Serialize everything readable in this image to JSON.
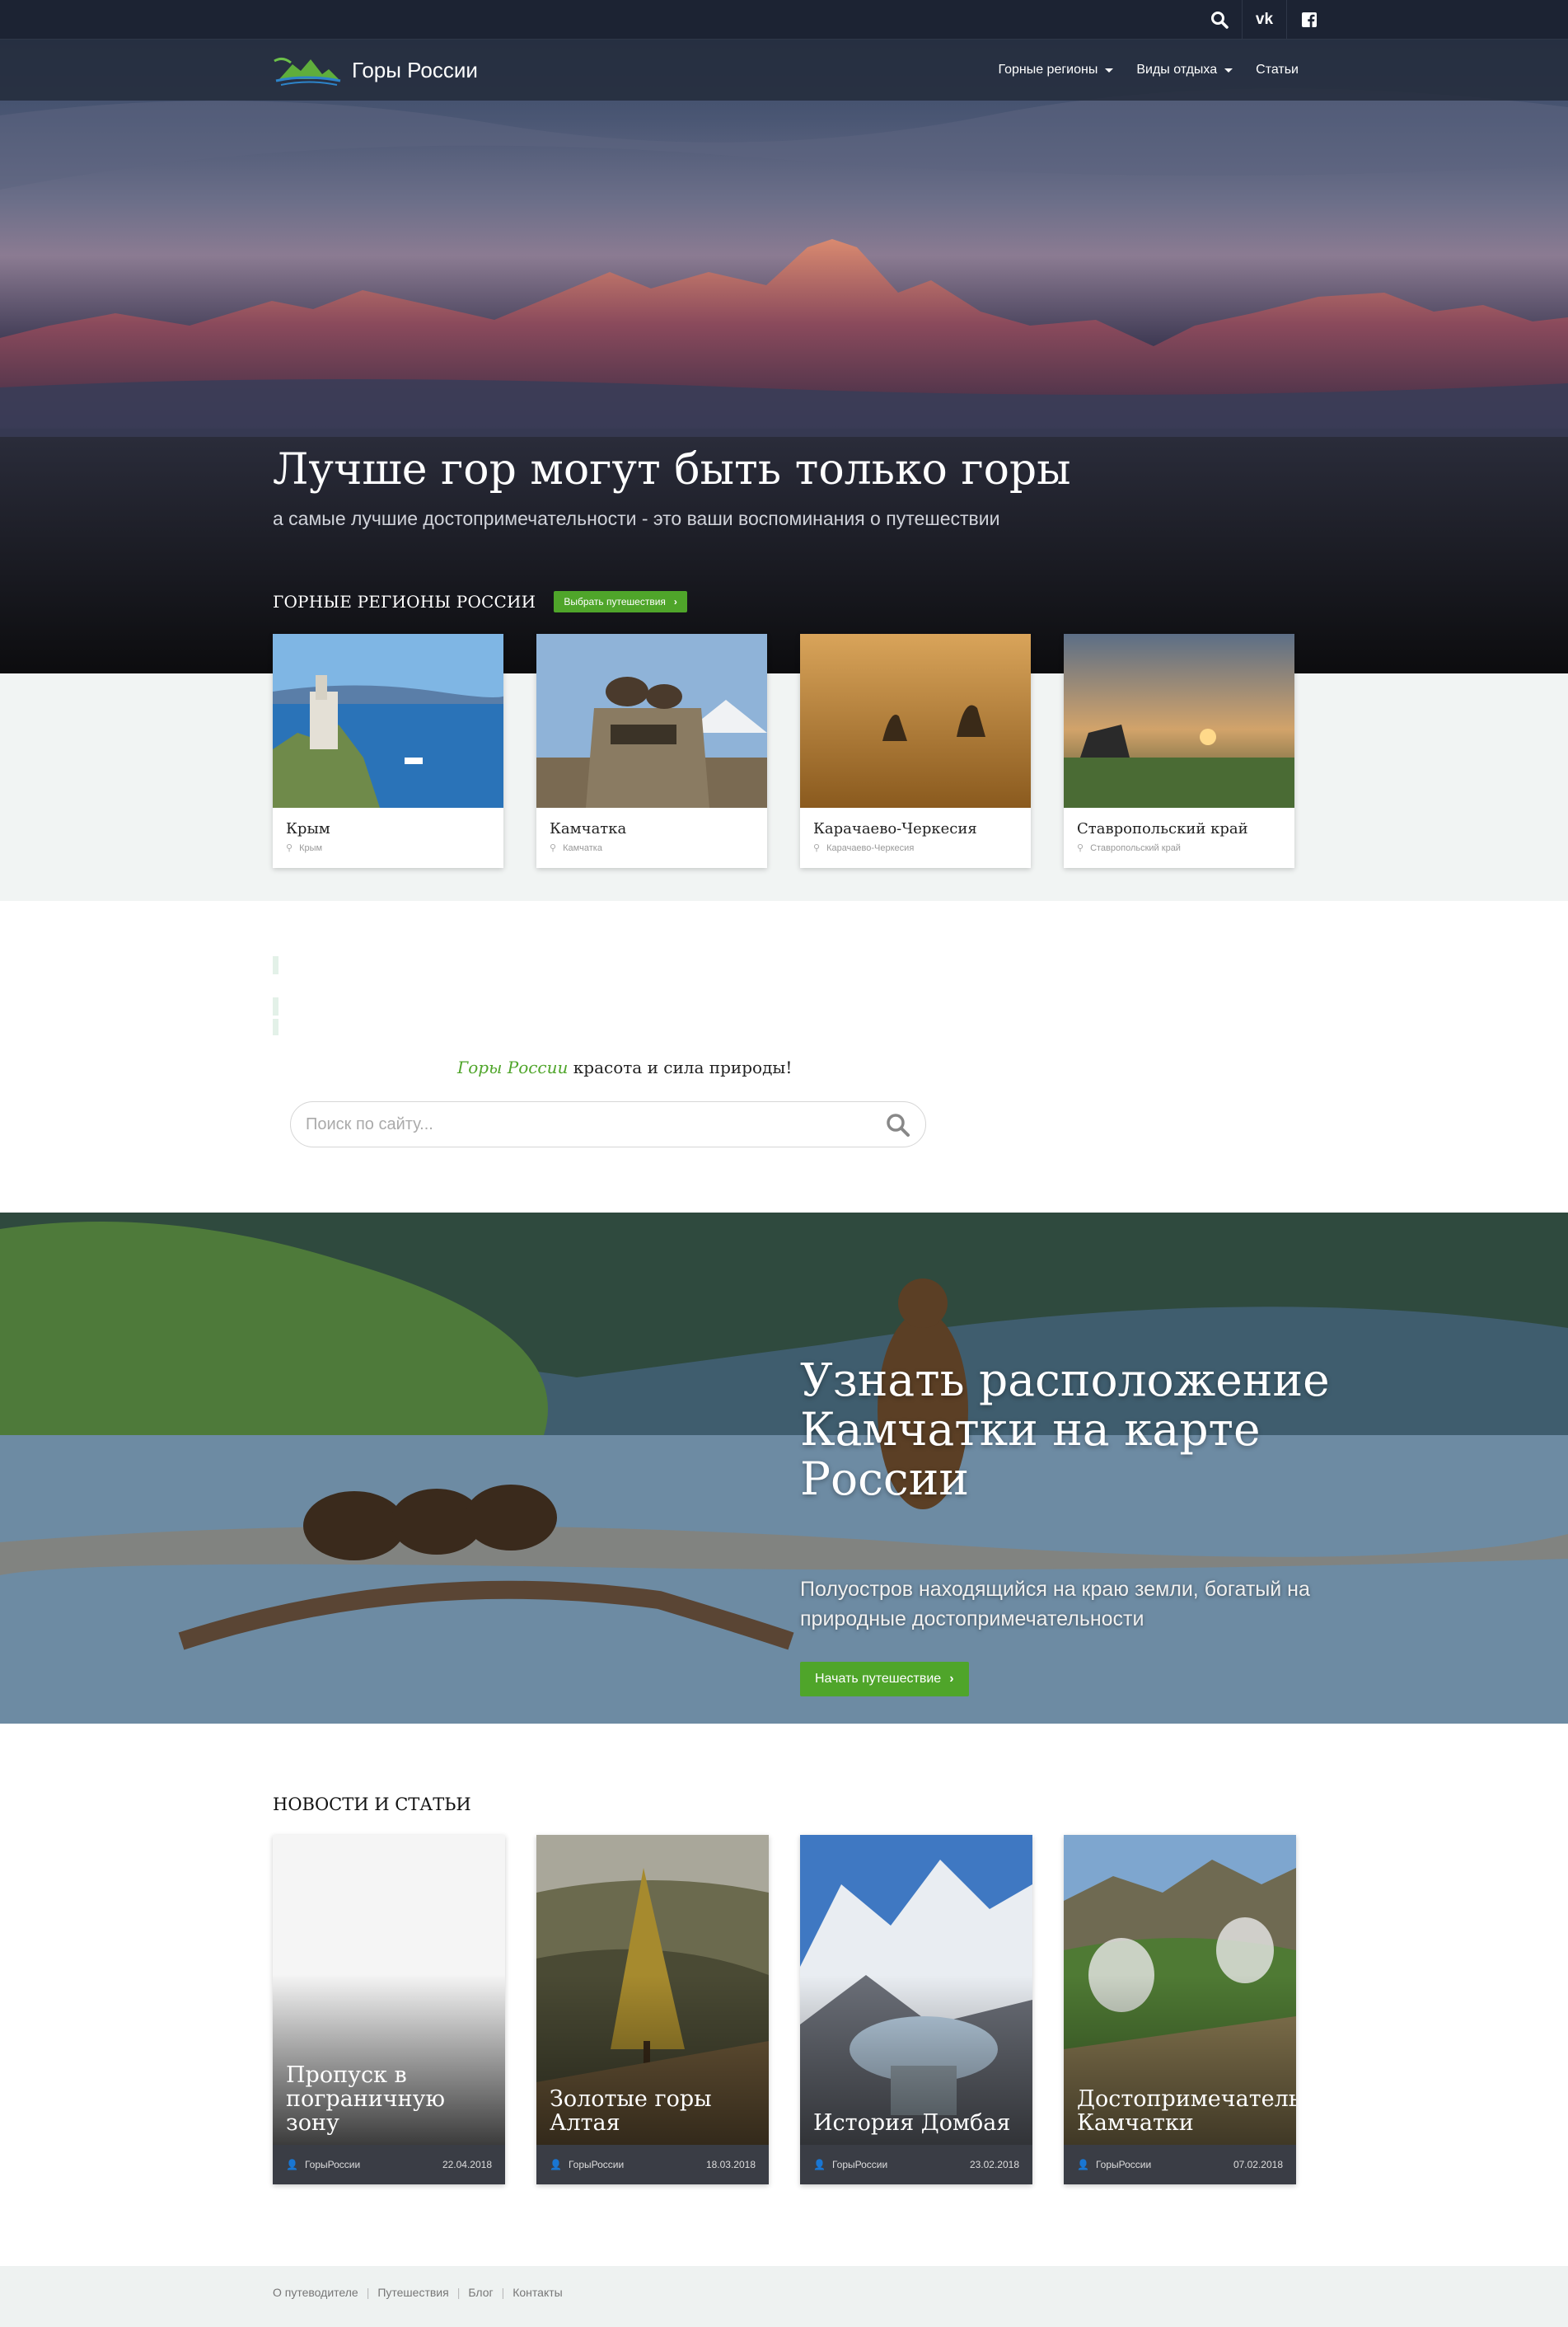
{
  "header": {
    "brand": "Горы России",
    "top_icons": [
      "search-icon",
      "vk-icon",
      "facebook-icon"
    ],
    "menu": [
      {
        "label": "Горные регионы",
        "dropdown": true
      },
      {
        "label": "Виды отдыха",
        "dropdown": true
      },
      {
        "label": "Статьи",
        "dropdown": false
      }
    ]
  },
  "hero": {
    "title": "Лучше гор могут быть только горы",
    "subtitle": "а самые лучшие достопримечательности - это ваши воспоминания о путешествии"
  },
  "regions": {
    "title": "ГОРНЫЕ РЕГИОНЫ РОССИИ",
    "button": "Выбрать путешествия",
    "cards": [
      {
        "name": "Крым",
        "location": "Крым"
      },
      {
        "name": "Камчатка",
        "location": "Камчатка"
      },
      {
        "name": "Карачаево-Черкесия",
        "location": "Карачаево-Черкесия"
      },
      {
        "name": "Ставропольский край",
        "location": "Ставропольский край"
      }
    ]
  },
  "tagline": {
    "accent": "Горы России",
    "rest": " красота и сила природы!"
  },
  "search": {
    "placeholder": "Поиск по сайту..."
  },
  "promo": {
    "title": "Узнать расположение Камчатки на карте России",
    "subtitle": "Полуостров находящийся на краю земли, богатый на природные достопримечательности",
    "button": "Начать путешествие"
  },
  "news": {
    "title": "НОВОСТИ И СТАТЬИ",
    "items": [
      {
        "title": "Пропуск в\nпограничную\nзону",
        "author": "ГорыРоссии",
        "date": "22.04.2018"
      },
      {
        "title": "Золотые горы\nАлтая",
        "author": "ГорыРоссии",
        "date": "18.03.2018"
      },
      {
        "title": "История Домбая",
        "author": "ГорыРоссии",
        "date": "23.02.2018"
      },
      {
        "title": "Достопримечательности\nКамчатки",
        "author": "ГорыРоссии",
        "date": "07.02.2018"
      }
    ]
  },
  "footer": {
    "links": [
      "О путеводителе",
      "Путешествия",
      "Блог",
      "Контакты"
    ]
  },
  "colors": {
    "accent_green": "#4fa52a",
    "nav_dark": "#1c2333",
    "band_bg": "#f1f4f3"
  }
}
